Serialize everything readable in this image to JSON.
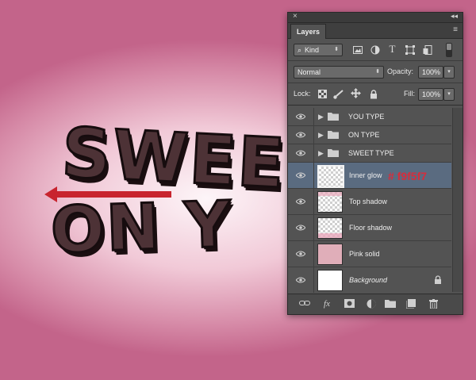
{
  "canvas": {
    "line1_text": "SWEE",
    "line2_text": "ON Y",
    "hex_annotation": "# f9f5f7",
    "arrow_color": "#c8242e",
    "text_color": "#4d3236"
  },
  "panel": {
    "close_glyph": "×",
    "collapse_glyph": "◂◂",
    "tab_label": "Layers",
    "menu_glyph": "≡",
    "filter": {
      "value": "Kind",
      "search_glyph": "⌕",
      "chev": "⬍"
    },
    "blend": {
      "value": "Normal",
      "chev": "⬍"
    },
    "opacity": {
      "label": "Opacity:",
      "value": "100%",
      "stepper": "▾"
    },
    "lock": {
      "label": "Lock:"
    },
    "fill": {
      "label": "Fill:",
      "value": "100%",
      "stepper": "▾"
    },
    "layers": [
      {
        "name": "YOU TYPE",
        "type": "group"
      },
      {
        "name": "ON TYPE",
        "type": "group"
      },
      {
        "name": "SWEET TYPE",
        "type": "group"
      },
      {
        "name": "Inner glow",
        "type": "layer",
        "selected": true
      },
      {
        "name": "Top shadow",
        "type": "layer"
      },
      {
        "name": "Floor shadow",
        "type": "layer"
      },
      {
        "name": "Pink solid",
        "type": "layer"
      },
      {
        "name": "Background",
        "type": "layer",
        "locked": true
      }
    ]
  },
  "colors": {
    "selected_row": "#5a6b80",
    "pink_solid": "#e0aeb9",
    "annotation_red": "#d62d3c"
  }
}
